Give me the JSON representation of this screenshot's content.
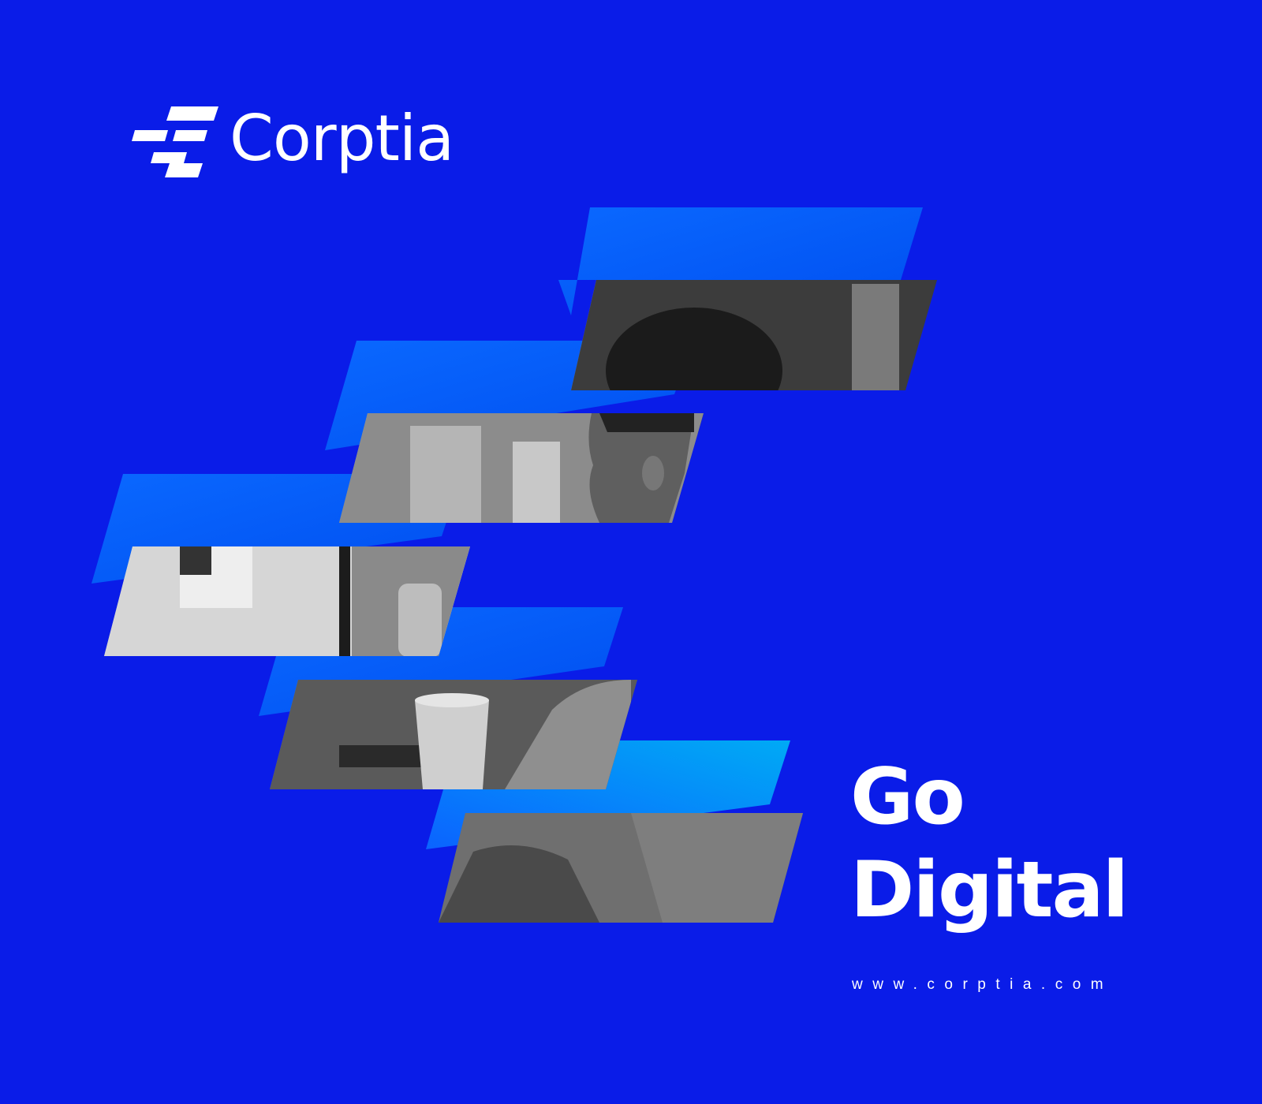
{
  "brand": {
    "name": "Corptia",
    "logo_icon": "stacked-stripes-logo-icon"
  },
  "headline": {
    "line1": "Go",
    "line2": "Digital"
  },
  "website": "www.corptia.com",
  "colors": {
    "background": "#0a1ce8",
    "band_light": "#1e7dff",
    "band_mid": "#0b5cf8",
    "band_cyan": "#00a6f5",
    "text": "#ffffff"
  },
  "photo": {
    "description_icon": "office-worker-at-computer-photo",
    "style": "grayscale"
  }
}
